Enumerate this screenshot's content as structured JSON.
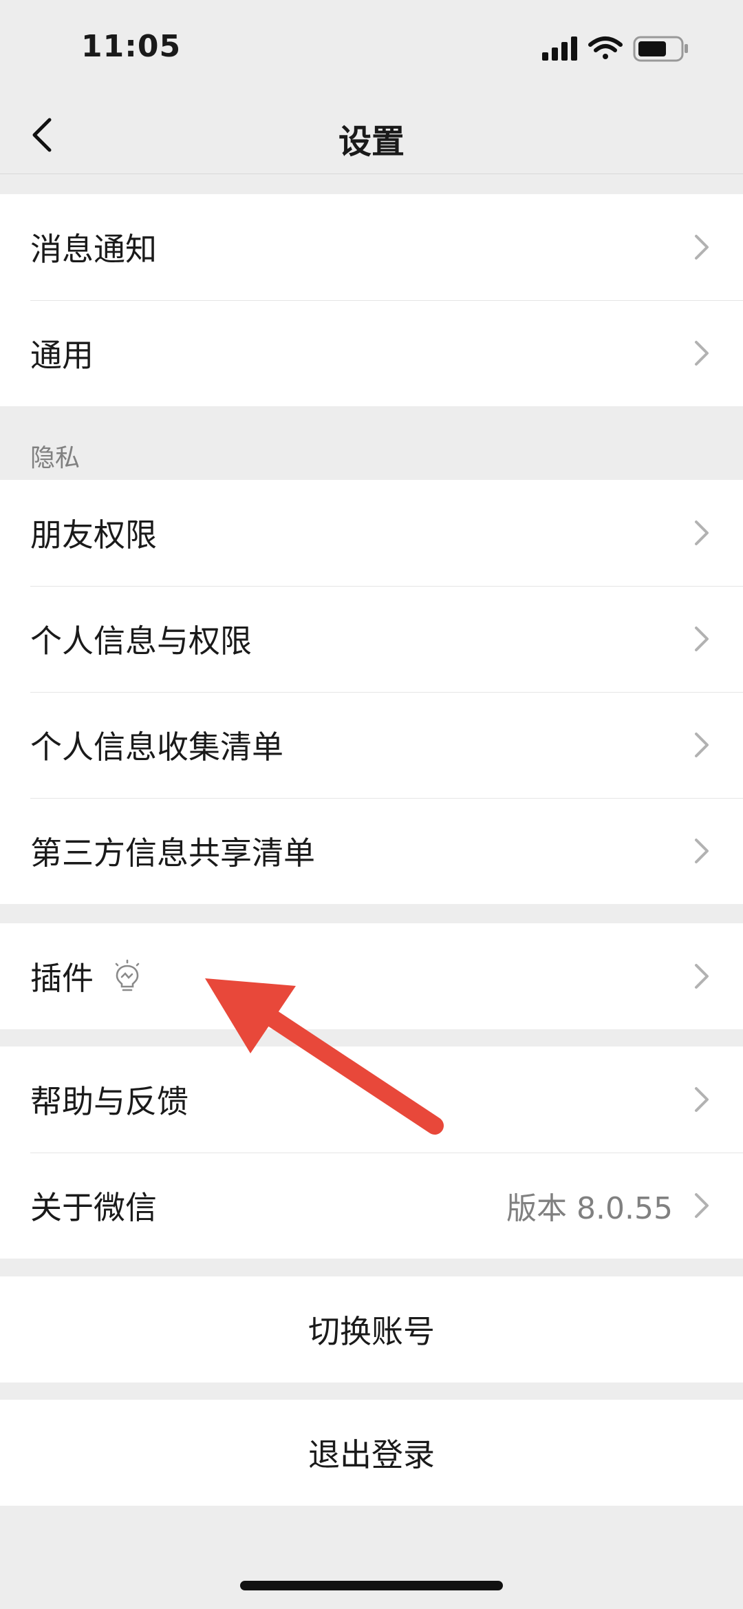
{
  "status_bar": {
    "time": "11:05"
  },
  "nav": {
    "title": "设置"
  },
  "groups": {
    "general": [
      {
        "label": "消息通知"
      },
      {
        "label": "通用"
      }
    ],
    "privacy_header": "隐私",
    "privacy": [
      {
        "label": "朋友权限"
      },
      {
        "label": "个人信息与权限"
      },
      {
        "label": "个人信息收集清单"
      },
      {
        "label": "第三方信息共享清单"
      }
    ],
    "plugins": {
      "label": "插件"
    },
    "about": [
      {
        "label": "帮助与反馈"
      },
      {
        "label": "关于微信",
        "value": "版本 8.0.55"
      }
    ],
    "switch_account": "切换账号",
    "logout": "退出登录"
  },
  "colors": {
    "background": "#ededed",
    "card": "#ffffff",
    "annotation_arrow": "#e8483a"
  }
}
